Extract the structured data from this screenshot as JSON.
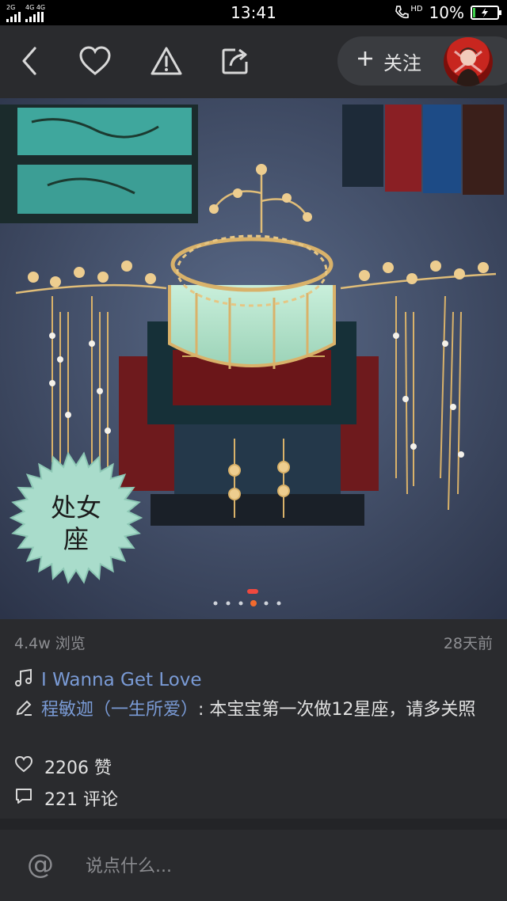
{
  "status_bar": {
    "network_1": "2G",
    "network_2": "4G 4G",
    "time": "13:41",
    "call_badge": "HD",
    "battery_text": "10%",
    "battery_level_percent": 10,
    "battery_color": "#3fd24b"
  },
  "toolbar": {
    "back_icon": "chevron-left-icon",
    "like_icon": "heart-icon",
    "report_icon": "warning-icon",
    "share_icon": "share-icon",
    "follow_label": "关注"
  },
  "post": {
    "sticker_text": "处女座",
    "carousel_active_index": 3,
    "carousel_count": 6,
    "views": "4.4w 浏览",
    "posted_ago": "28天前",
    "music_title": "I Wanna Get Love",
    "author": "程敏迦（一生所爱）",
    "caption": ": 本宝宝第一次做12星座，请多关照",
    "likes": "2206 赞",
    "comments": "221 评论"
  },
  "comment_bar": {
    "placeholder": "说点什么..."
  },
  "colors": {
    "background": "#2a2b2e",
    "link": "#7a9bd6",
    "muted": "#8e8f93",
    "accent_dot": "#f26a2e"
  }
}
